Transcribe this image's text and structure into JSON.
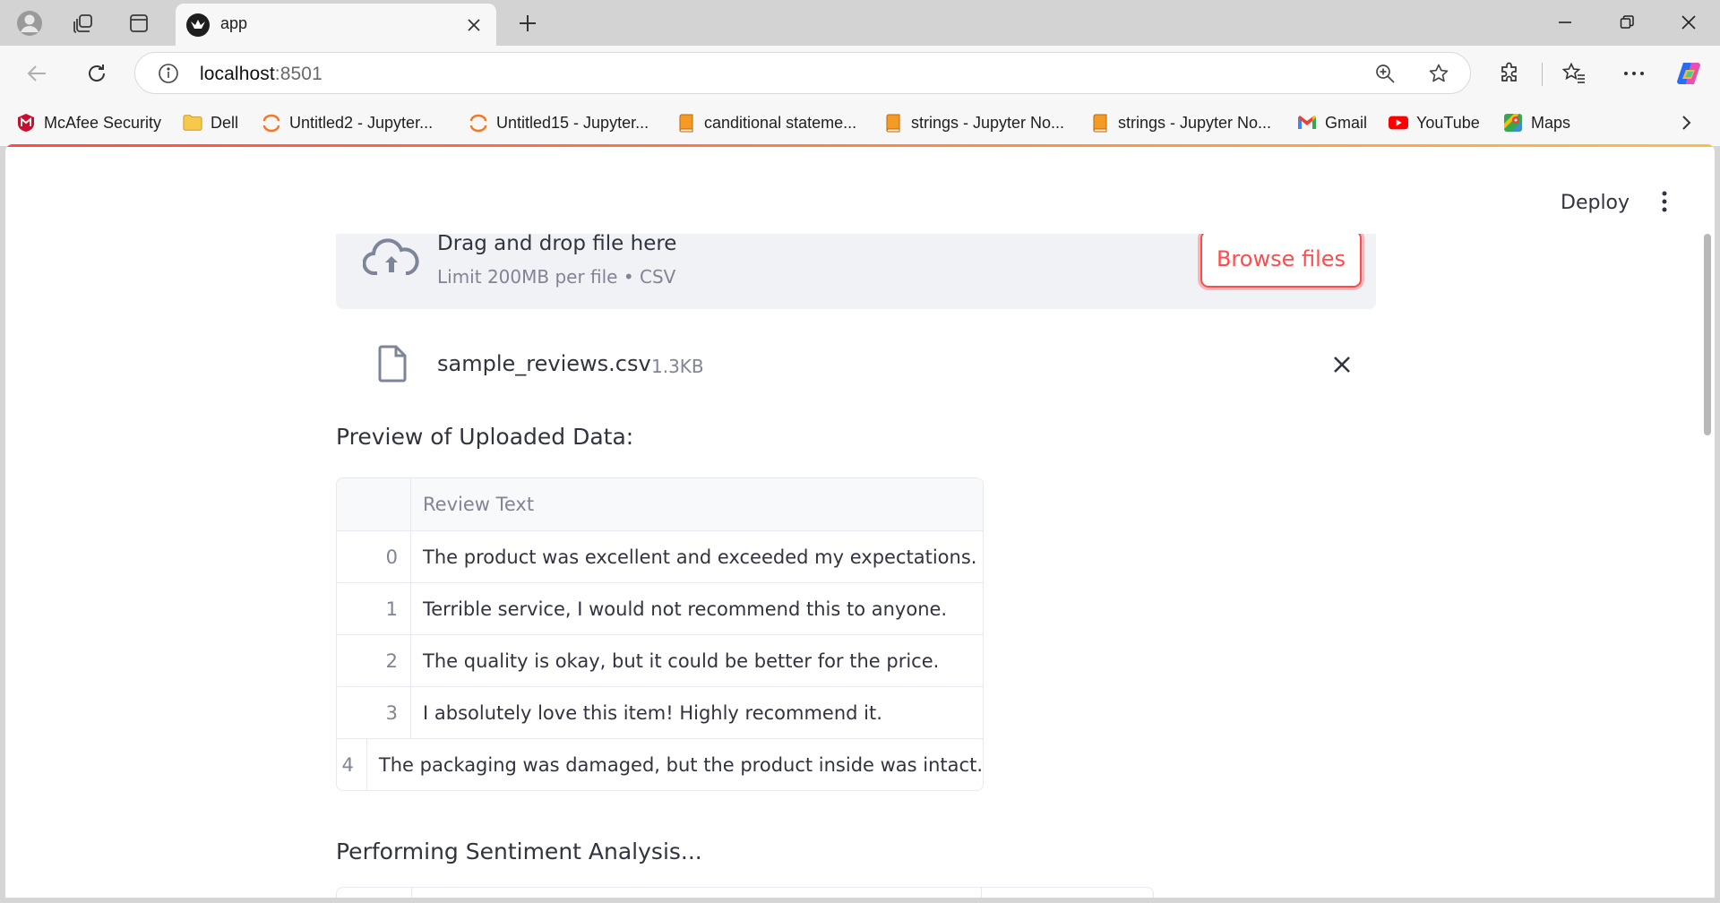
{
  "browser": {
    "tab_title": "app",
    "url_host": "localhost",
    "url_port": ":8501",
    "bookmarks": [
      {
        "label": "McAfee Security",
        "icon": "mcafee-icon"
      },
      {
        "label": "Dell",
        "icon": "folder-icon"
      },
      {
        "label": "Untitled2 - Jupyter...",
        "icon": "jupyter-icon"
      },
      {
        "label": "Untitled15 - Jupyter...",
        "icon": "jupyter-icon"
      },
      {
        "label": "canditional stateme...",
        "icon": "notebook-icon"
      },
      {
        "label": "strings - Jupyter No...",
        "icon": "notebook-icon"
      },
      {
        "label": "strings - Jupyter No...",
        "icon": "notebook-icon"
      },
      {
        "label": "Gmail",
        "icon": "gmail-icon"
      },
      {
        "label": "YouTube",
        "icon": "youtube-icon"
      },
      {
        "label": "Maps",
        "icon": "maps-icon"
      }
    ]
  },
  "app": {
    "deploy_label": "Deploy",
    "uploader": {
      "title": "Drag and drop file here",
      "limit": "Limit 200MB per file • CSV",
      "browse_label": "Browse files"
    },
    "file": {
      "name": "sample_reviews.csv",
      "size": "1.3KB"
    },
    "preview_label": "Preview of Uploaded Data:",
    "table": {
      "column": "Review Text",
      "rows": [
        {
          "index": "0",
          "text": "The product was excellent and exceeded my expectations."
        },
        {
          "index": "1",
          "text": "Terrible service, I would not recommend this to anyone."
        },
        {
          "index": "2",
          "text": "The quality is okay, but it could be better for the price."
        },
        {
          "index": "3",
          "text": "I absolutely love this item! Highly recommend it."
        },
        {
          "index": "4",
          "text": "The packaging was damaged, but the product inside was intact."
        }
      ]
    },
    "analysis_label": "Performing Sentiment Analysis..."
  },
  "colors": {
    "accent": "#ff4b4b",
    "text": "#31333f",
    "muted": "#808495",
    "dropzone_bg": "#f0f2f6"
  }
}
